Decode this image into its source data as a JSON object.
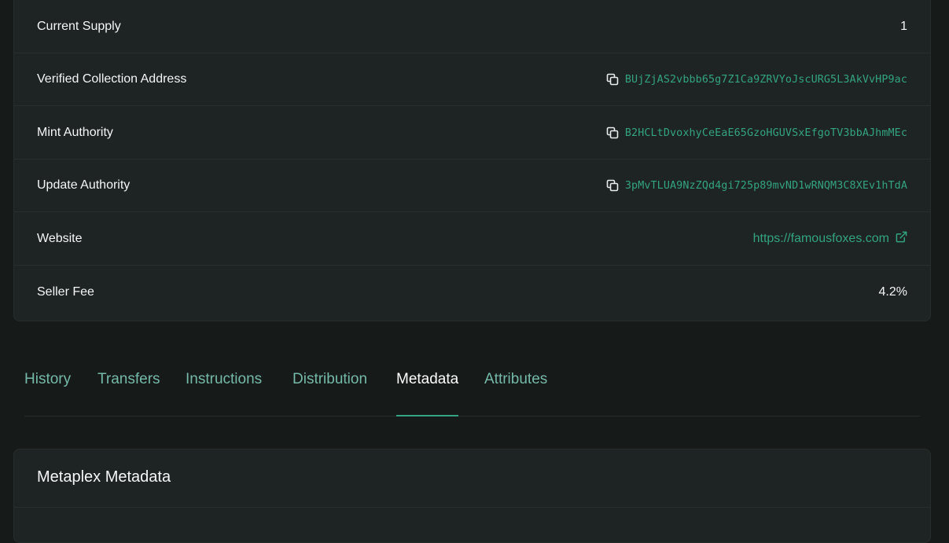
{
  "details": {
    "rows": [
      {
        "label": "Current Supply",
        "value": "1"
      },
      {
        "label": "Verified Collection Address",
        "value": "BUjZjAS2vbbb65g7Z1Ca9ZRVYoJscURG5L3AkVvHP9ac"
      },
      {
        "label": "Mint Authority",
        "value": "B2HCLtDvoxhyCeEaE65GzoHGUVSxEfgoTV3bbAJhmMEc"
      },
      {
        "label": "Update Authority",
        "value": "3pMvTLUA9NzZQd4gi725p89mvND1wRNQM3C8XEv1hTdA"
      },
      {
        "label": "Website",
        "value": "https://famousfoxes.com"
      },
      {
        "label": "Seller Fee",
        "value": "4.2%"
      }
    ]
  },
  "tabs": [
    {
      "label": "History"
    },
    {
      "label": "Transfers"
    },
    {
      "label": "Instructions"
    },
    {
      "label": "Distribution"
    },
    {
      "label": "Metadata",
      "active": true
    },
    {
      "label": "Attributes"
    }
  ],
  "metadata_card": {
    "title": "Metaplex Metadata"
  },
  "colors": {
    "background": "#161a19",
    "card": "#1e2423",
    "accent": "#33a382",
    "tab_inactive": "#75b9a8"
  },
  "icons": {
    "copy": "copy-icon",
    "external_link": "external-link-icon"
  }
}
